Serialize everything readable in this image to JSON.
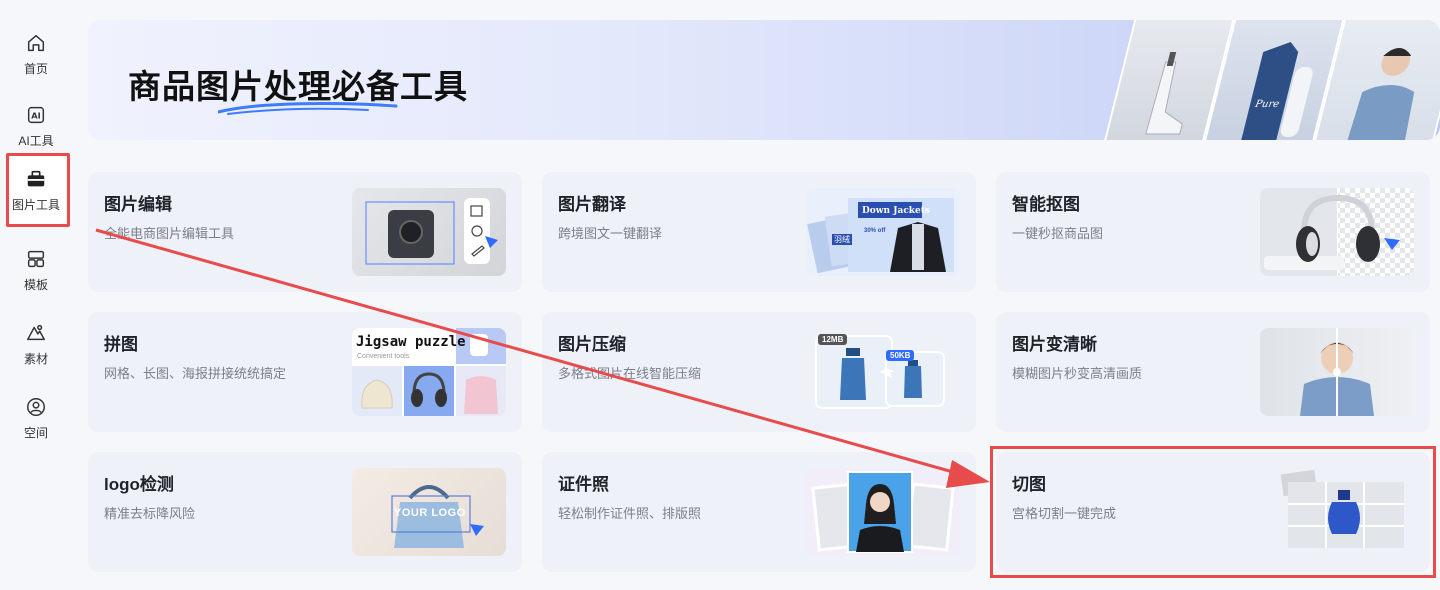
{
  "sidebar": {
    "items": [
      {
        "label": "首页",
        "icon": "home-icon"
      },
      {
        "label": "AI工具",
        "icon": "ai-icon"
      },
      {
        "label": "图片工具",
        "icon": "toolbox-icon"
      },
      {
        "label": "模板",
        "icon": "template-icon"
      },
      {
        "label": "素材",
        "icon": "material-icon"
      },
      {
        "label": "空间",
        "icon": "user-space-icon"
      }
    ],
    "active_index": 2
  },
  "banner": {
    "title": "商品图片处理必备工具",
    "photo_text": "Pure"
  },
  "cards": [
    {
      "title": "图片编辑",
      "desc": "全能电商图片编辑工具"
    },
    {
      "title": "图片翻译",
      "desc": "跨境图文一键翻译",
      "img_text": "Down Jackets",
      "img_sub": "30% off",
      "img_tag": "羽绒"
    },
    {
      "title": "智能抠图",
      "desc": "一键秒抠商品图"
    },
    {
      "title": "拼图",
      "desc": "网格、长图、海报拼接统统搞定",
      "img_text": "Jigsaw puzzle",
      "img_sub": "Convenient tools"
    },
    {
      "title": "图片压缩",
      "desc": "多格式图片在线智能压缩",
      "img_before": "12MB",
      "img_after": "50KB"
    },
    {
      "title": "图片变清晰",
      "desc": "模糊图片秒变高清画质"
    },
    {
      "title": "logo检测",
      "desc": "精准去标降风险",
      "img_text": "YOUR LOGO"
    },
    {
      "title": "证件照",
      "desc": "轻松制作证件照、排版照"
    },
    {
      "title": "切图",
      "desc": "宫格切割一键完成"
    }
  ],
  "colors": {
    "highlight": "#e84b4b",
    "accent": "#2f6bff",
    "card_bg": "#eef1f8"
  }
}
